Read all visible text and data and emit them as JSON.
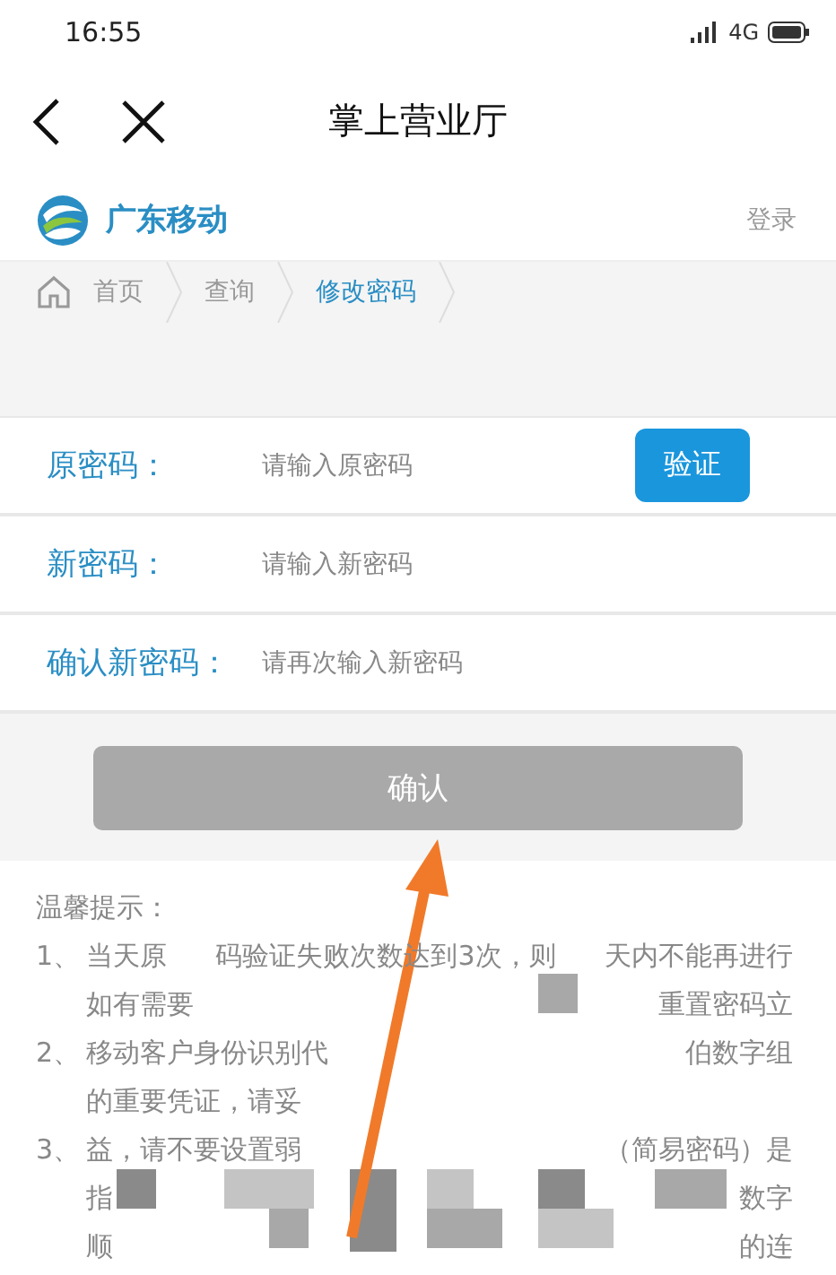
{
  "status_bar": {
    "time": "16:55",
    "network": "4G"
  },
  "header": {
    "title": "掌上营业厅"
  },
  "brand": {
    "name": "广东移动",
    "login": "登录"
  },
  "breadcrumb": [
    {
      "label": "首页",
      "selected": false
    },
    {
      "label": "查询",
      "selected": false
    },
    {
      "label": "修改密码",
      "selected": true
    }
  ],
  "form": {
    "rows": [
      {
        "label": "原密码：",
        "placeholder": "请输入原密码",
        "button": "验证"
      },
      {
        "label": "新密码：",
        "placeholder": "请输入新密码"
      },
      {
        "label": "确认新密码：",
        "placeholder": "请再次输入新密码"
      }
    ],
    "submit": {
      "label": "确认",
      "disabled": true
    }
  },
  "tips": {
    "title": "温馨提示：",
    "items": [
      {
        "number": "1、",
        "lines": [
          [
            "当天原",
            "码验证失败次数达到3次，则",
            "天内不能再进行"
          ],
          [
            "如有需要",
            "重置密码立"
          ]
        ]
      },
      {
        "number": "2、",
        "lines": [
          [
            "移动客户身份识别代",
            "伯数字组"
          ],
          [
            "的重要凭证，请妥"
          ]
        ]
      },
      {
        "number": "3、",
        "lines": [
          [
            "益，请不要设置弱",
            "（简易密码）是"
          ],
          [
            "指",
            "数字"
          ],
          [
            "顺",
            "的连"
          ]
        ]
      }
    ]
  }
}
